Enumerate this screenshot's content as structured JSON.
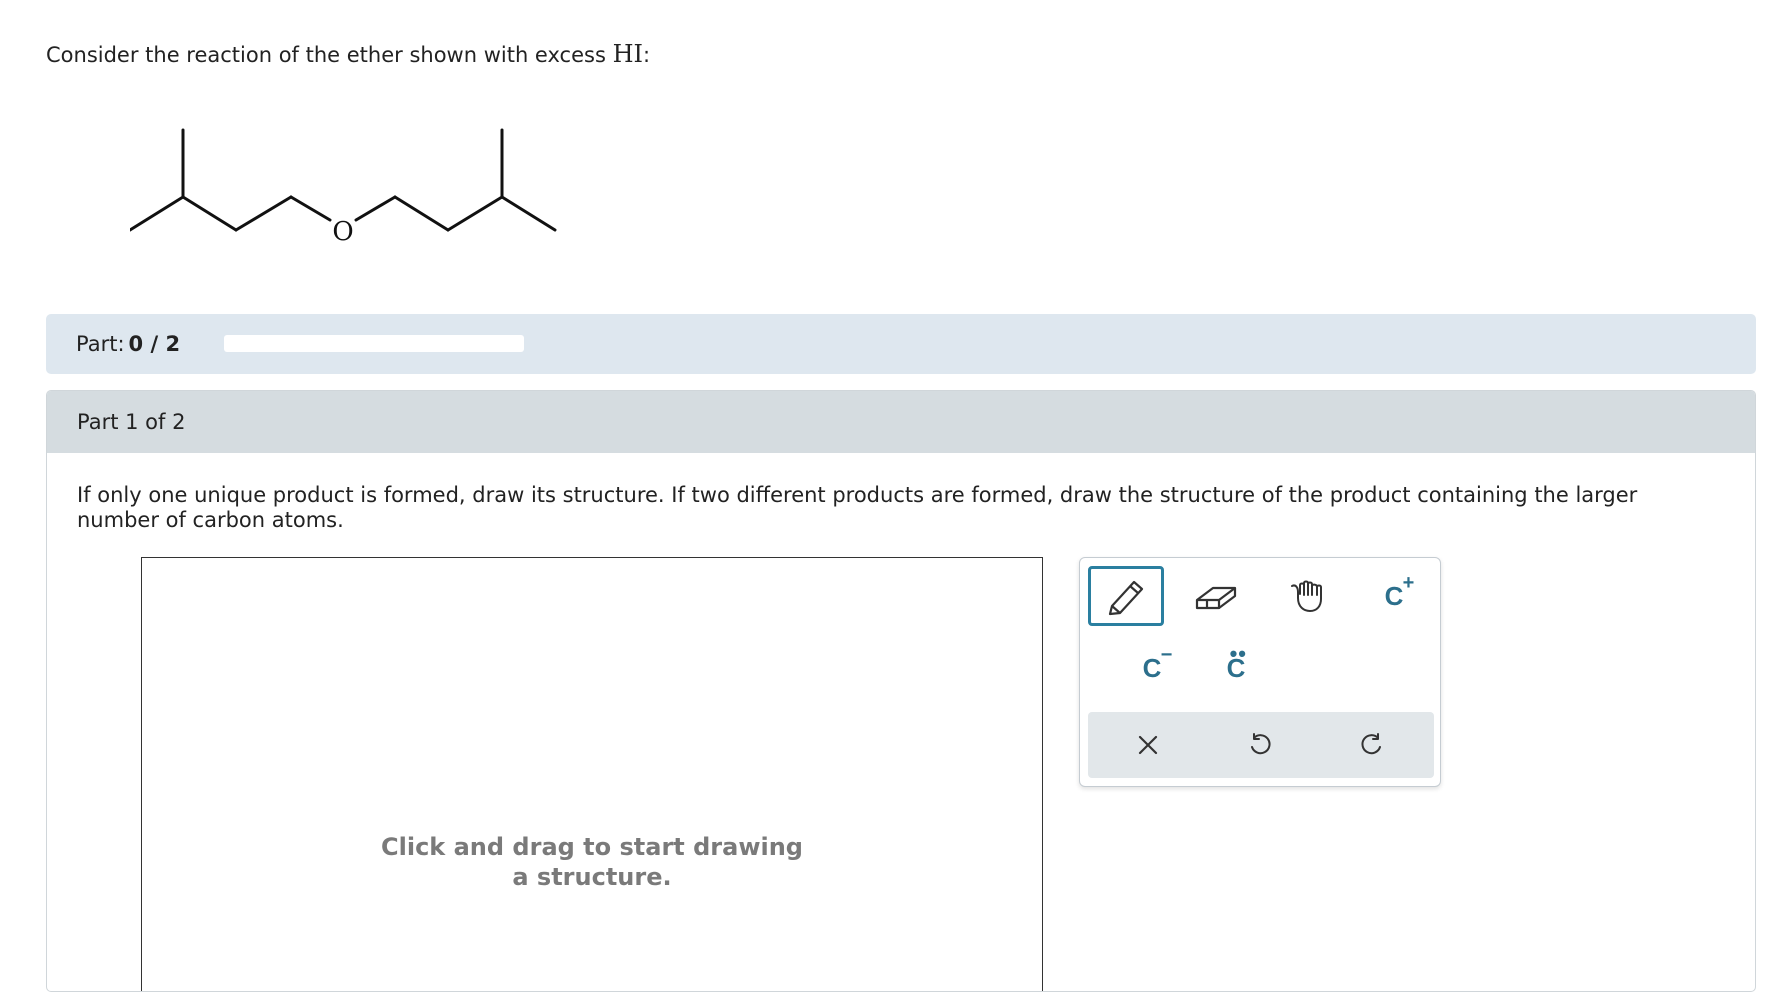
{
  "question": {
    "text": "Consider the reaction of the ether shown with excess ",
    "formula": "HI",
    "suffix": ":"
  },
  "molecule": {
    "oxygen_label": "O"
  },
  "progress": {
    "label": "Part:",
    "value": "0 / 2",
    "fraction": 0
  },
  "part": {
    "title": "Part 1 of 2",
    "instructions": "If only one unique product is formed, draw its structure. If two different products are formed, draw the structure of the product containing the larger number of carbon atoms."
  },
  "canvas": {
    "hint": "Click and drag to start drawing a structure."
  },
  "toolbar": {
    "tools": [
      {
        "name": "pencil-icon",
        "selected": true
      },
      {
        "name": "eraser-icon",
        "selected": false
      },
      {
        "name": "hand-icon",
        "selected": false
      },
      {
        "name": "carbocation-icon",
        "label": "C",
        "charge": "+"
      },
      {
        "name": "carbanion-icon",
        "label": "C",
        "charge": "−"
      },
      {
        "name": "lone-pair-icon",
        "label": "C",
        "dots": "••"
      }
    ],
    "actions": [
      "clear-icon",
      "undo-icon",
      "redo-icon"
    ],
    "accent_color": "#2a7fa0"
  }
}
